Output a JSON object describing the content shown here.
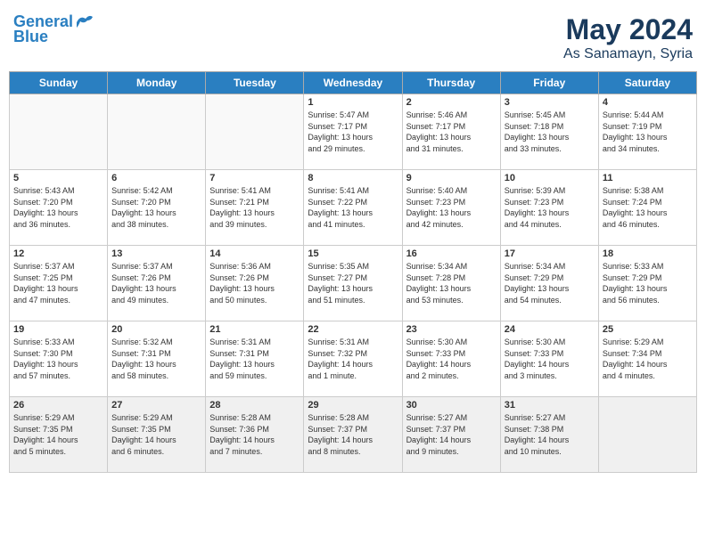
{
  "header": {
    "logo_line1": "General",
    "logo_line2": "Blue",
    "title": "May 2024",
    "subtitle": "As Sanamayn, Syria"
  },
  "weekdays": [
    "Sunday",
    "Monday",
    "Tuesday",
    "Wednesday",
    "Thursday",
    "Friday",
    "Saturday"
  ],
  "weeks": [
    [
      {
        "day": "",
        "info": ""
      },
      {
        "day": "",
        "info": ""
      },
      {
        "day": "",
        "info": ""
      },
      {
        "day": "1",
        "info": "Sunrise: 5:47 AM\nSunset: 7:17 PM\nDaylight: 13 hours\nand 29 minutes."
      },
      {
        "day": "2",
        "info": "Sunrise: 5:46 AM\nSunset: 7:17 PM\nDaylight: 13 hours\nand 31 minutes."
      },
      {
        "day": "3",
        "info": "Sunrise: 5:45 AM\nSunset: 7:18 PM\nDaylight: 13 hours\nand 33 minutes."
      },
      {
        "day": "4",
        "info": "Sunrise: 5:44 AM\nSunset: 7:19 PM\nDaylight: 13 hours\nand 34 minutes."
      }
    ],
    [
      {
        "day": "5",
        "info": "Sunrise: 5:43 AM\nSunset: 7:20 PM\nDaylight: 13 hours\nand 36 minutes."
      },
      {
        "day": "6",
        "info": "Sunrise: 5:42 AM\nSunset: 7:20 PM\nDaylight: 13 hours\nand 38 minutes."
      },
      {
        "day": "7",
        "info": "Sunrise: 5:41 AM\nSunset: 7:21 PM\nDaylight: 13 hours\nand 39 minutes."
      },
      {
        "day": "8",
        "info": "Sunrise: 5:41 AM\nSunset: 7:22 PM\nDaylight: 13 hours\nand 41 minutes."
      },
      {
        "day": "9",
        "info": "Sunrise: 5:40 AM\nSunset: 7:23 PM\nDaylight: 13 hours\nand 42 minutes."
      },
      {
        "day": "10",
        "info": "Sunrise: 5:39 AM\nSunset: 7:23 PM\nDaylight: 13 hours\nand 44 minutes."
      },
      {
        "day": "11",
        "info": "Sunrise: 5:38 AM\nSunset: 7:24 PM\nDaylight: 13 hours\nand 46 minutes."
      }
    ],
    [
      {
        "day": "12",
        "info": "Sunrise: 5:37 AM\nSunset: 7:25 PM\nDaylight: 13 hours\nand 47 minutes."
      },
      {
        "day": "13",
        "info": "Sunrise: 5:37 AM\nSunset: 7:26 PM\nDaylight: 13 hours\nand 49 minutes."
      },
      {
        "day": "14",
        "info": "Sunrise: 5:36 AM\nSunset: 7:26 PM\nDaylight: 13 hours\nand 50 minutes."
      },
      {
        "day": "15",
        "info": "Sunrise: 5:35 AM\nSunset: 7:27 PM\nDaylight: 13 hours\nand 51 minutes."
      },
      {
        "day": "16",
        "info": "Sunrise: 5:34 AM\nSunset: 7:28 PM\nDaylight: 13 hours\nand 53 minutes."
      },
      {
        "day": "17",
        "info": "Sunrise: 5:34 AM\nSunset: 7:29 PM\nDaylight: 13 hours\nand 54 minutes."
      },
      {
        "day": "18",
        "info": "Sunrise: 5:33 AM\nSunset: 7:29 PM\nDaylight: 13 hours\nand 56 minutes."
      }
    ],
    [
      {
        "day": "19",
        "info": "Sunrise: 5:33 AM\nSunset: 7:30 PM\nDaylight: 13 hours\nand 57 minutes."
      },
      {
        "day": "20",
        "info": "Sunrise: 5:32 AM\nSunset: 7:31 PM\nDaylight: 13 hours\nand 58 minutes."
      },
      {
        "day": "21",
        "info": "Sunrise: 5:31 AM\nSunset: 7:31 PM\nDaylight: 13 hours\nand 59 minutes."
      },
      {
        "day": "22",
        "info": "Sunrise: 5:31 AM\nSunset: 7:32 PM\nDaylight: 14 hours\nand 1 minute."
      },
      {
        "day": "23",
        "info": "Sunrise: 5:30 AM\nSunset: 7:33 PM\nDaylight: 14 hours\nand 2 minutes."
      },
      {
        "day": "24",
        "info": "Sunrise: 5:30 AM\nSunset: 7:33 PM\nDaylight: 14 hours\nand 3 minutes."
      },
      {
        "day": "25",
        "info": "Sunrise: 5:29 AM\nSunset: 7:34 PM\nDaylight: 14 hours\nand 4 minutes."
      }
    ],
    [
      {
        "day": "26",
        "info": "Sunrise: 5:29 AM\nSunset: 7:35 PM\nDaylight: 14 hours\nand 5 minutes."
      },
      {
        "day": "27",
        "info": "Sunrise: 5:29 AM\nSunset: 7:35 PM\nDaylight: 14 hours\nand 6 minutes."
      },
      {
        "day": "28",
        "info": "Sunrise: 5:28 AM\nSunset: 7:36 PM\nDaylight: 14 hours\nand 7 minutes."
      },
      {
        "day": "29",
        "info": "Sunrise: 5:28 AM\nSunset: 7:37 PM\nDaylight: 14 hours\nand 8 minutes."
      },
      {
        "day": "30",
        "info": "Sunrise: 5:27 AM\nSunset: 7:37 PM\nDaylight: 14 hours\nand 9 minutes."
      },
      {
        "day": "31",
        "info": "Sunrise: 5:27 AM\nSunset: 7:38 PM\nDaylight: 14 hours\nand 10 minutes."
      },
      {
        "day": "",
        "info": ""
      }
    ]
  ]
}
